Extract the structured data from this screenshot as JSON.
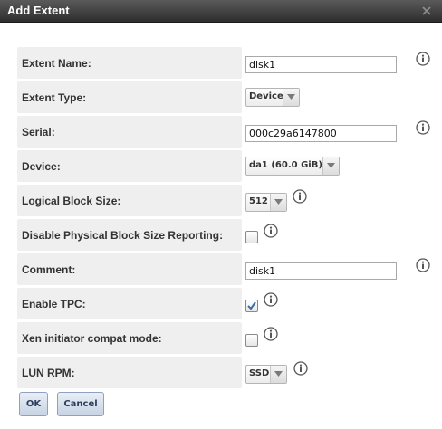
{
  "dialog": {
    "title": "Add Extent"
  },
  "fields": {
    "extent_name": {
      "label": "Extent Name:",
      "value": "disk1"
    },
    "extent_type": {
      "label": "Extent Type:",
      "value": "Device"
    },
    "serial": {
      "label": "Serial:",
      "value": "000c29a6147800"
    },
    "device": {
      "label": "Device:",
      "value": "da1 (60.0 GiB)"
    },
    "logical_block_size": {
      "label": "Logical Block Size:",
      "value": "512"
    },
    "disable_pbs_reporting": {
      "label": "Disable Physical Block Size Reporting:",
      "checked": false
    },
    "comment": {
      "label": "Comment:",
      "value": "disk1"
    },
    "enable_tpc": {
      "label": "Enable TPC:",
      "checked": true
    },
    "xen_compat": {
      "label": "Xen initiator compat mode:",
      "checked": false
    },
    "lun_rpm": {
      "label": "LUN RPM:",
      "value": "SSD"
    }
  },
  "buttons": {
    "ok": "OK",
    "cancel": "Cancel"
  },
  "colors": {
    "titlebar": "#3c3c3c",
    "label_bg": "#efefef",
    "info_icon": "#555555",
    "checkmark": "#3a6ea5",
    "button_text": "#2a3e5e"
  },
  "icons": {
    "close": "close-icon",
    "info": "info-icon",
    "dropdown": "chevron-down-icon",
    "check": "checkmark-icon"
  }
}
